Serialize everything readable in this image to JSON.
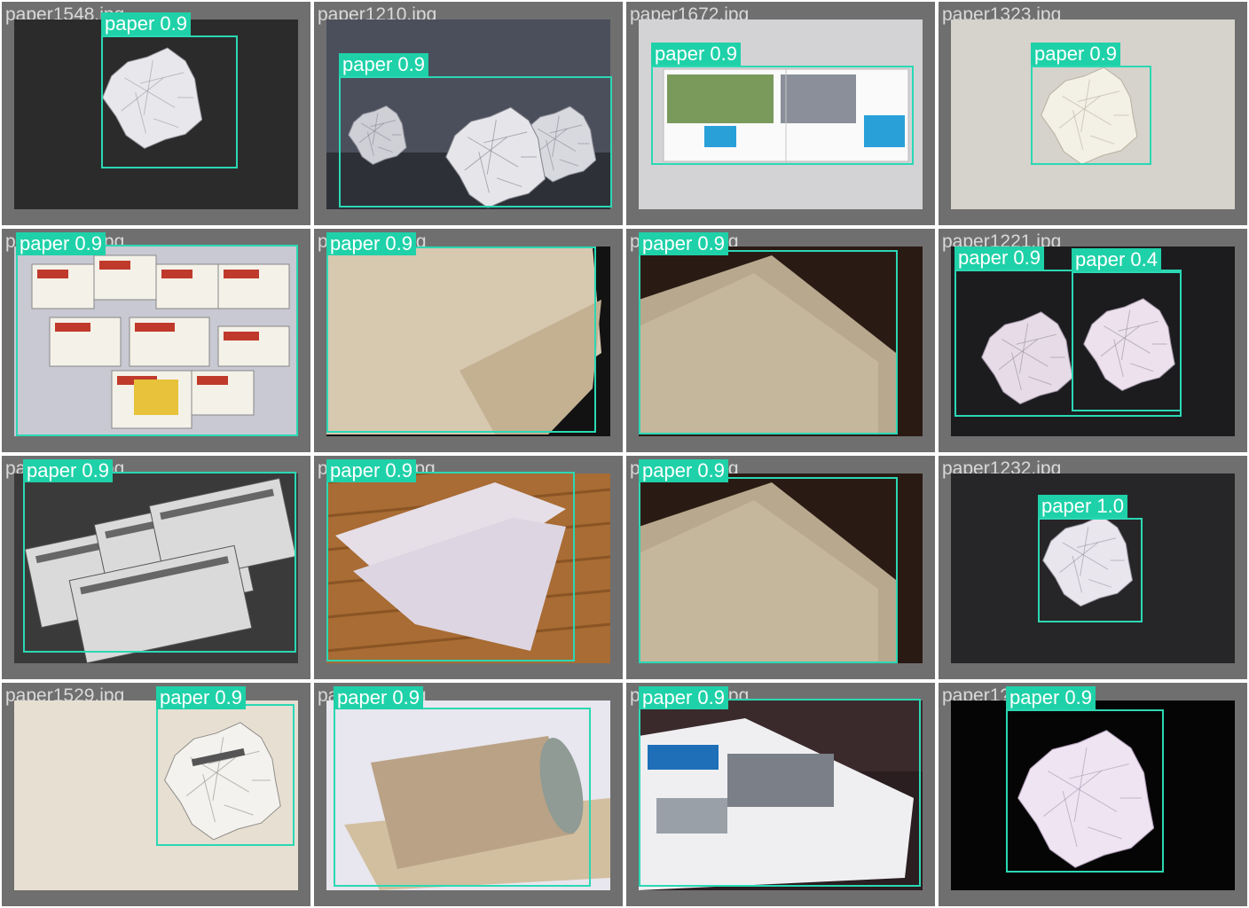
{
  "grid": {
    "cells": [
      {
        "filename": "paper1548.jpg",
        "detections": [
          {
            "label": "paper 0.9"
          }
        ]
      },
      {
        "filename": "paper1210.jpg",
        "detections": [
          {
            "label": "paper 0.9"
          }
        ]
      },
      {
        "filename": "paper1672.jpg",
        "detections": [
          {
            "label": "paper 0.9"
          }
        ]
      },
      {
        "filename": "paper1323.jpg",
        "detections": [
          {
            "label": "paper 0.9"
          }
        ]
      },
      {
        "filename": "paper1080.jpg",
        "detections": [
          {
            "label": "paper 0.9"
          }
        ]
      },
      {
        "filename": "paper1??.jpg",
        "detections": [
          {
            "label": "paper 0.9"
          }
        ]
      },
      {
        "filename": "paper1??.jpg",
        "detections": [
          {
            "label": "paper 0.9"
          }
        ]
      },
      {
        "filename": "paper1221.jpg",
        "detections": [
          {
            "label": "paper 0.9"
          },
          {
            "label": "paper 0.4"
          }
        ]
      },
      {
        "filename": "paper1281.jpg",
        "detections": [
          {
            "label": "paper 0.9"
          }
        ]
      },
      {
        "filename": "paper1107.jpg",
        "detections": [
          {
            "label": "paper 0.9"
          }
        ]
      },
      {
        "filename": "paper1??.jpg",
        "detections": [
          {
            "label": "paper 0.9"
          }
        ]
      },
      {
        "filename": "paper1232.jpg",
        "detections": [
          {
            "label": "paper 1.0"
          }
        ]
      },
      {
        "filename": "paper1529.jpg",
        "detections": [
          {
            "label": "paper 0.9"
          }
        ]
      },
      {
        "filename": "paper1??.jpg",
        "detections": [
          {
            "label": "paper 0.9"
          }
        ]
      },
      {
        "filename": "paper1030.jpg",
        "detections": [
          {
            "label": "paper 0.9"
          }
        ]
      },
      {
        "filename": "paper1??.jpg",
        "detections": [
          {
            "label": "paper 0.9"
          }
        ]
      }
    ]
  },
  "colors": {
    "cell_bg": "#6f6f6f",
    "box_stroke": "#2bd8b4",
    "label_bg": "#1fd1a8",
    "label_text": "#ffffff",
    "filename_text": "#d9d9d9"
  },
  "scene_types": [
    "crumpled-ball-dark",
    "crumpled-wads-blue",
    "brochure-spread",
    "crumpled-ball-beige",
    "coupons-binder",
    "beige-sheet-fold",
    "brown-sheets-table",
    "two-crumpled-dark",
    "newspapers-bw",
    "sheets-on-wood",
    "brown-sheets-table",
    "crumpled-ball-black",
    "crumpled-ball-cream",
    "cardboard-tube",
    "newspaper-welcome-mat",
    "crumpled-ball-purple"
  ]
}
